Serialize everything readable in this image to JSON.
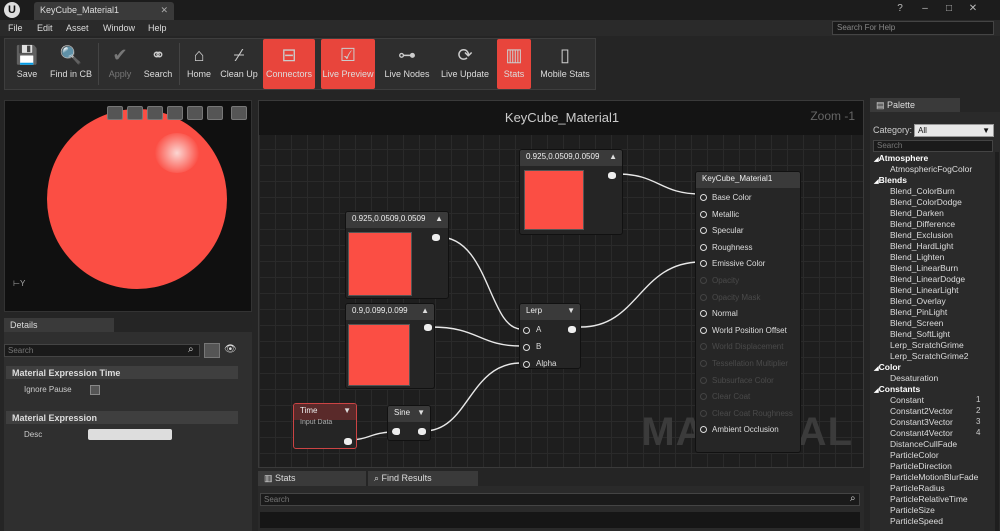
{
  "window": {
    "doc_tab": "KeyCube_Material1"
  },
  "menu": [
    "File",
    "Edit",
    "Asset",
    "Window",
    "Help"
  ],
  "help_search": {
    "placeholder": "Search For Help"
  },
  "toolbar": [
    {
      "label": "Save",
      "icon": "save-icon"
    },
    {
      "label": "Find in CB",
      "icon": "magnifier-icon"
    },
    {
      "label": "Apply",
      "icon": "checkmark-icon"
    },
    {
      "label": "Search",
      "icon": "binoculars-icon"
    },
    {
      "label": "Home",
      "icon": "house-icon"
    },
    {
      "label": "Clean Up",
      "icon": "broom-icon"
    },
    {
      "label": "Connectors",
      "icon": "connectors-icon"
    },
    {
      "label": "Live Preview",
      "icon": "preview-check-icon"
    },
    {
      "label": "Live Nodes",
      "icon": "nodes-icon"
    },
    {
      "label": "Live Update",
      "icon": "update-icon"
    },
    {
      "label": "Stats",
      "icon": "stats-icon"
    },
    {
      "label": "Mobile Stats",
      "icon": "mobile-icon"
    }
  ],
  "viewport": {
    "axis_label": "Y",
    "color": "#fb4e44"
  },
  "details": {
    "tab": "Details",
    "search_placeholder": "Search",
    "sections": [
      {
        "title": "Material Expression Time",
        "prop": "Ignore Pause"
      },
      {
        "title": "Material Expression",
        "prop": "Desc"
      }
    ]
  },
  "graph": {
    "title": "KeyCube_Material1",
    "zoom": "Zoom -1",
    "watermark": "MATERIAL",
    "nodes": {
      "const_top": "0.925,0.0509,0.0509",
      "const_mid": "0.925,0.0509,0.0509",
      "const_low": "0.9,0.099,0.099",
      "time": "Time",
      "time_sub": "Input Data",
      "sine": "Sine",
      "lerp": "Lerp",
      "lerp_pins": [
        "A",
        "B",
        "Alpha"
      ],
      "result": "KeyCube_Material1",
      "result_pins": [
        {
          "label": "Base Color",
          "enabled": true
        },
        {
          "label": "Metallic",
          "enabled": true
        },
        {
          "label": "Specular",
          "enabled": true
        },
        {
          "label": "Roughness",
          "enabled": true
        },
        {
          "label": "Emissive Color",
          "enabled": true
        },
        {
          "label": "Opacity",
          "enabled": false
        },
        {
          "label": "Opacity Mask",
          "enabled": false
        },
        {
          "label": "Normal",
          "enabled": true
        },
        {
          "label": "World Position Offset",
          "enabled": true
        },
        {
          "label": "World Displacement",
          "enabled": false
        },
        {
          "label": "Tessellation Multiplier",
          "enabled": false
        },
        {
          "label": "Subsurface Color",
          "enabled": false
        },
        {
          "label": "Clear Coat",
          "enabled": false
        },
        {
          "label": "Clear Coat Roughness",
          "enabled": false
        },
        {
          "label": "Ambient Occlusion",
          "enabled": true
        }
      ]
    }
  },
  "bottom": {
    "tabs": [
      "Stats",
      "Find Results"
    ],
    "search_placeholder": "Search"
  },
  "palette": {
    "tab": "Palette",
    "category_label": "Category:",
    "category_value": "All",
    "search_placeholder": "Search",
    "entries": [
      {
        "type": "cat",
        "text": "Atmosphere"
      },
      {
        "type": "item",
        "text": "AtmosphericFogColor"
      },
      {
        "type": "cat",
        "text": "Blends"
      },
      {
        "type": "item",
        "text": "Blend_ColorBurn"
      },
      {
        "type": "item",
        "text": "Blend_ColorDodge"
      },
      {
        "type": "item",
        "text": "Blend_Darken"
      },
      {
        "type": "item",
        "text": "Blend_Difference"
      },
      {
        "type": "item",
        "text": "Blend_Exclusion"
      },
      {
        "type": "item",
        "text": "Blend_HardLight"
      },
      {
        "type": "item",
        "text": "Blend_Lighten"
      },
      {
        "type": "item",
        "text": "Blend_LinearBurn"
      },
      {
        "type": "item",
        "text": "Blend_LinearDodge"
      },
      {
        "type": "item",
        "text": "Blend_LinearLight"
      },
      {
        "type": "item",
        "text": "Blend_Overlay"
      },
      {
        "type": "item",
        "text": "Blend_PinLight"
      },
      {
        "type": "item",
        "text": "Blend_Screen"
      },
      {
        "type": "item",
        "text": "Blend_SoftLight"
      },
      {
        "type": "item",
        "text": "Lerp_ScratchGrime"
      },
      {
        "type": "item",
        "text": "Lerp_ScratchGrime2"
      },
      {
        "type": "cat",
        "text": "Color"
      },
      {
        "type": "item",
        "text": "Desaturation"
      },
      {
        "type": "cat",
        "text": "Constants"
      },
      {
        "type": "item",
        "text": "Constant",
        "num": "1"
      },
      {
        "type": "item",
        "text": "Constant2Vector",
        "num": "2"
      },
      {
        "type": "item",
        "text": "Constant3Vector",
        "num": "3"
      },
      {
        "type": "item",
        "text": "Constant4Vector",
        "num": "4"
      },
      {
        "type": "item",
        "text": "DistanceCullFade"
      },
      {
        "type": "item",
        "text": "ParticleColor"
      },
      {
        "type": "item",
        "text": "ParticleDirection"
      },
      {
        "type": "item",
        "text": "ParticleMotionBlurFade"
      },
      {
        "type": "item",
        "text": "ParticleRadius"
      },
      {
        "type": "item",
        "text": "ParticleRelativeTime"
      },
      {
        "type": "item",
        "text": "ParticleSize"
      },
      {
        "type": "item",
        "text": "ParticleSpeed"
      }
    ]
  }
}
